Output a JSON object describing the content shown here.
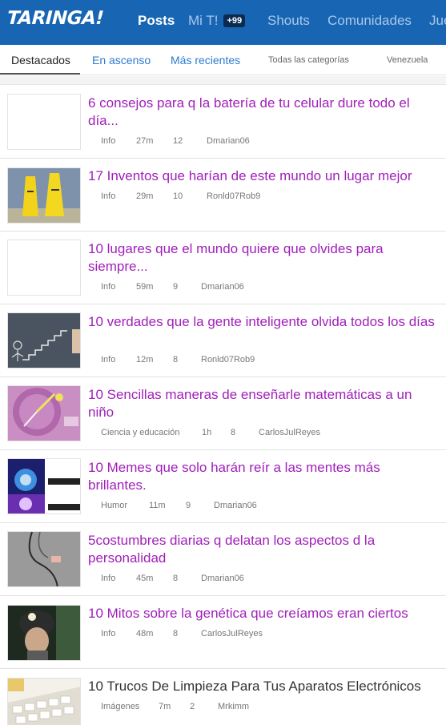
{
  "header": {
    "logo": "TARINGA!",
    "nav": [
      {
        "label": "Posts"
      },
      {
        "label": "Mi T!",
        "badge": "+99"
      },
      {
        "label": "Shouts"
      },
      {
        "label": "Comunidades"
      },
      {
        "label": "Jue"
      }
    ]
  },
  "subnav": {
    "tabs": [
      {
        "label": "Destacados"
      },
      {
        "label": "En ascenso"
      },
      {
        "label": "Más recientes"
      }
    ],
    "category": "Todas las categorías",
    "country": "Venezuela"
  },
  "posts": [
    {
      "title": "6 consejos para q la batería de tu celular dure todo el día...",
      "category": "Info",
      "time": "27m",
      "points": "12",
      "author": "Dmarian06",
      "thumb": "blank"
    },
    {
      "title": "17 Inventos que harían de este mundo un lugar mejor",
      "category": "Info",
      "time": "29m",
      "points": "10",
      "author": "Ronld07Rob9",
      "thumb": "yellow-figures"
    },
    {
      "title": "10 lugares que el mundo quiere que olvides para siempre...",
      "category": "Info",
      "time": "59m",
      "points": "9",
      "author": "Dmarian06",
      "thumb": "blank"
    },
    {
      "title": "10 verdades que la gente inteligente olvida todos los días",
      "category": "Info",
      "time": "12m",
      "points": "8",
      "author": "Ronld07Rob9",
      "thumb": "chalkboard-stairs"
    },
    {
      "title": "10 Sencillas maneras de enseñarle matemáticas a un niño",
      "category": "Ciencia y educación",
      "time": "1h",
      "points": "8",
      "author": "CarlosJulReyes",
      "thumb": "purple-clock"
    },
    {
      "title": "10 Memes que solo harán reír a las mentes más brillantes.",
      "category": "Humor",
      "time": "11m",
      "points": "9",
      "author": "Dmarian06",
      "thumb": "brain-meme"
    },
    {
      "title": "5costumbres diarias q delatan los aspectos d la personalidad",
      "category": "Info",
      "time": "45m",
      "points": "8",
      "author": "Dmarian06",
      "thumb": "wire-gray"
    },
    {
      "title": "10 Mitos sobre la genética que creíamos eran ciertos",
      "category": "Info",
      "time": "48m",
      "points": "8",
      "author": "CarlosJulReyes",
      "thumb": "child-helmet"
    },
    {
      "title": "10 Trucos De Limpieza Para Tus Aparatos Electrónicos",
      "category": "Imágenes",
      "time": "7m",
      "points": "2",
      "author": "Mrkimm",
      "thumb": "keyboard"
    }
  ]
}
